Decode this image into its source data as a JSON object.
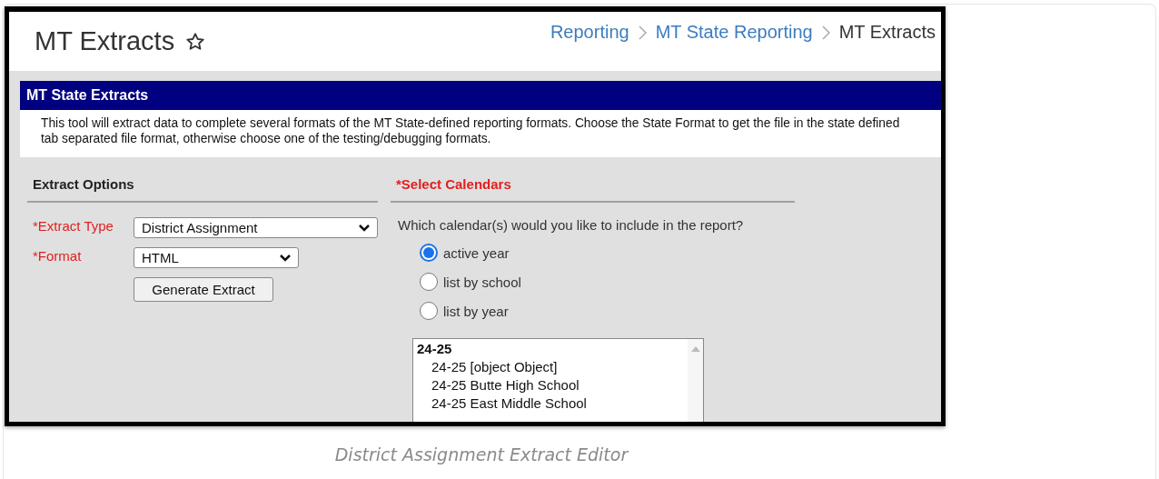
{
  "header": {
    "title": "MT Extracts",
    "favorite": false,
    "breadcrumbs": [
      {
        "label": "Reporting",
        "kind": "link"
      },
      {
        "label": "MT State Reporting",
        "kind": "link"
      },
      {
        "label": "MT Extracts",
        "kind": "current"
      }
    ]
  },
  "panel": {
    "title": "MT State Extracts",
    "description": "This tool will extract data to complete several formats of the MT State-defined reporting formats. Choose the State Format to get the file in the state defined tab separated file format, otherwise choose one of the testing/debugging formats."
  },
  "extract_options": {
    "heading": "Extract Options",
    "fields": [
      {
        "label": "*Extract Type",
        "value": "District Assignment",
        "kind": "wide"
      },
      {
        "label": "*Format",
        "value": "HTML",
        "kind": "narrow"
      }
    ],
    "button": "Generate Extract"
  },
  "calendars": {
    "heading": "*Select Calendars",
    "question": "Which calendar(s) would you like to include in the report?",
    "options": [
      {
        "label": "active year",
        "selected": true
      },
      {
        "label": "list by school",
        "selected": false
      },
      {
        "label": "list by year",
        "selected": false
      }
    ],
    "list": [
      {
        "label": "24-25",
        "children": [
          {
            "label": "24-25 [object Object]"
          },
          {
            "label": "24-25 Butte High School"
          },
          {
            "label": "24-25 East Middle School"
          }
        ]
      }
    ]
  },
  "caption": "District Assignment Extract Editor"
}
